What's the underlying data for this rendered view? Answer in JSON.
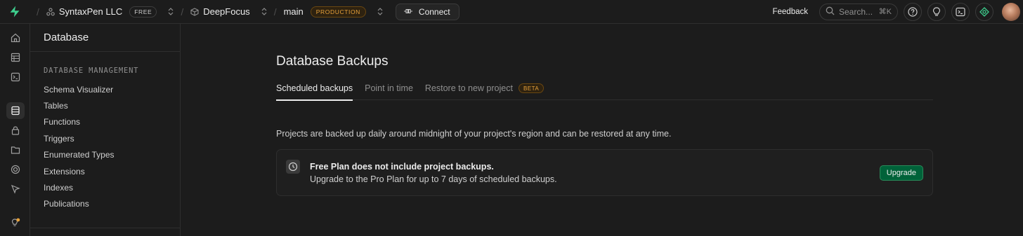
{
  "topbar": {
    "org_name": "SyntaxPen LLC",
    "org_badge": "FREE",
    "project_name": "DeepFocus",
    "branch_name": "main",
    "branch_badge": "PRODUCTION",
    "connect_label": "Connect",
    "feedback_label": "Feedback",
    "search_placeholder": "Search...",
    "search_shortcut": "⌘K"
  },
  "sidebar": {
    "title": "Database",
    "section_label": "DATABASE MANAGEMENT",
    "items": [
      {
        "label": "Schema Visualizer"
      },
      {
        "label": "Tables"
      },
      {
        "label": "Functions"
      },
      {
        "label": "Triggers"
      },
      {
        "label": "Enumerated Types"
      },
      {
        "label": "Extensions"
      },
      {
        "label": "Indexes"
      },
      {
        "label": "Publications"
      }
    ]
  },
  "main": {
    "title": "Database Backups",
    "tabs": [
      {
        "label": "Scheduled backups"
      },
      {
        "label": "Point in time"
      },
      {
        "label": "Restore to new project"
      }
    ],
    "beta_badge": "BETA",
    "description": "Projects are backed up daily around midnight of your project's region and can be restored at any time.",
    "notice_title": "Free Plan does not include project backups.",
    "notice_text": "Upgrade to the Pro Plan for up to 7 days of scheduled backups.",
    "upgrade_label": "Upgrade"
  },
  "colors": {
    "accent_green": "#3ecf8e",
    "warning_amber": "#e8a23a",
    "upgrade_green": "#006239"
  }
}
